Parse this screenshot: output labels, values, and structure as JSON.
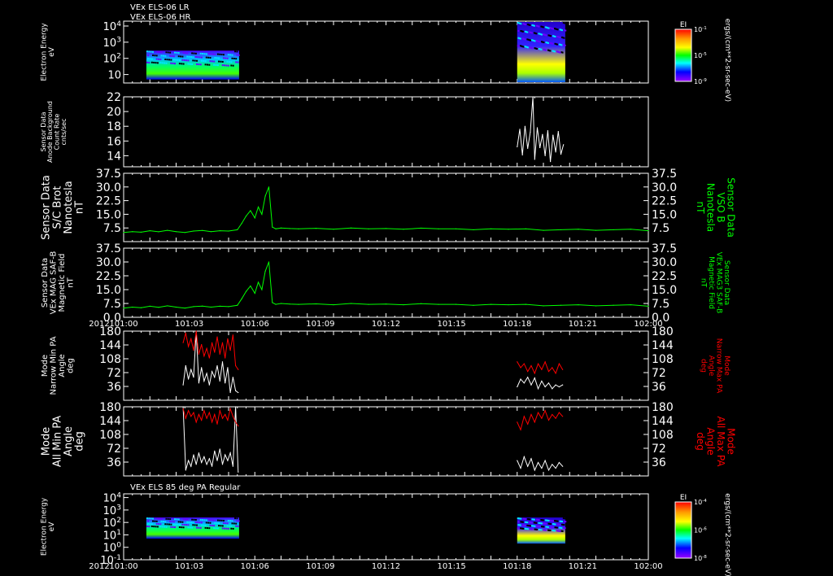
{
  "header": {
    "line1": "VEx ELS-06 LR",
    "line2": "VEx ELS-06 HR",
    "bottom_panel_title": "VEx ELS 85 deg PA Regular"
  },
  "colors": {
    "background": "#000000",
    "frame": "#ffffff",
    "text": "#ffffff",
    "green": "#00ff00",
    "red": "#ff0000"
  },
  "xaxis": {
    "year_label": "2012",
    "ticks": [
      "101:00",
      "101:03",
      "101:06",
      "101:09",
      "101:12",
      "101:15",
      "101:18",
      "101:21",
      "102:00"
    ],
    "range_minutes": [
      0,
      60
    ]
  },
  "chart_data": [
    {
      "id": "p1",
      "type": "heatmap",
      "ylabel_lines": [
        "Electron Energy",
        "eV"
      ],
      "ylog": true,
      "yticks": [
        "10",
        "10^2",
        "10^3",
        "10^4"
      ],
      "colorbar": {
        "title": "EI",
        "ticks": [
          "10^-1",
          "10^-5",
          "10^-9"
        ],
        "label": "ergs/(cm**2-sr-sec-eV)"
      },
      "blocks": [
        {
          "x0": 2.6,
          "x1": 13.2,
          "e0": 5,
          "e1": 300
        },
        {
          "x0": 45.0,
          "x1": 50.5,
          "e0": 3,
          "e1": 30000
        }
      ]
    },
    {
      "id": "p2",
      "type": "line",
      "ylabel_lines": [
        "Sensor Data",
        "Anode Background",
        "Count Rate",
        "cnts/sec"
      ],
      "ylim": [
        12.5,
        22
      ],
      "yticks": [
        "14",
        "16",
        "18",
        "20",
        "22"
      ],
      "x": [
        45.0,
        45.3,
        45.6,
        45.9,
        46.2,
        46.5,
        46.8,
        47.0,
        47.3,
        47.6,
        47.9,
        48.2,
        48.5,
        48.8,
        49.1,
        49.4,
        49.7,
        50.0,
        50.3
      ],
      "values": [
        15.2,
        17.6,
        14.1,
        18.0,
        15.0,
        17.2,
        22.0,
        13.5,
        17.8,
        15.1,
        16.9,
        14.0,
        17.4,
        13.2,
        16.8,
        14.5,
        17.3,
        14.2,
        15.5
      ]
    },
    {
      "id": "p3",
      "type": "line",
      "ylabel_lines": [
        "Sensor Data",
        "S/C Brot",
        "Nanotesla",
        "nT"
      ],
      "rlabel_lines": [
        "Sensor Data",
        "VSO B",
        "Nanotesla",
        "nT"
      ],
      "ylim": [
        0,
        37.5
      ],
      "yticks": [
        "7.5",
        "15.0",
        "22.5",
        "30.0",
        "37.5"
      ],
      "rticks": [
        "7.5",
        "15.0",
        "22.5",
        "30.0",
        "37.5"
      ],
      "x": [
        0,
        1,
        2,
        3,
        4,
        5,
        6,
        7,
        8,
        9,
        10,
        11,
        12,
        13,
        13.5,
        14,
        14.5,
        15,
        15.4,
        15.8,
        16.2,
        16.6,
        17.0,
        17.4,
        18,
        19,
        20,
        22,
        24,
        26,
        28,
        30,
        32,
        34,
        36,
        38,
        40,
        42,
        44,
        46,
        48,
        50,
        52,
        54,
        56,
        58,
        60
      ],
      "values": [
        5,
        5.5,
        5.2,
        6,
        5.4,
        6.2,
        5.5,
        5,
        5.8,
        6.1,
        5.5,
        6,
        5.8,
        6.5,
        10,
        14,
        17,
        13,
        19,
        15,
        25,
        30,
        8,
        7,
        7.5,
        7.2,
        7,
        7.3,
        6.8,
        7.5,
        7,
        7.2,
        6.8,
        7.4,
        7,
        7,
        6.5,
        7,
        6.8,
        7,
        6.2,
        6.5,
        6.8,
        6.2,
        6.5,
        6.8,
        6
      ]
    },
    {
      "id": "p4",
      "type": "line",
      "ylabel_lines": [
        "Sensor Data",
        "VEx MAG SAF-B",
        "Magnetic Field",
        "nT"
      ],
      "rlabel_lines": [
        "Sensor Data",
        "VEx MAG3 SAF-B",
        "Magnetic Field",
        "nT"
      ],
      "ylim": [
        0,
        37.5
      ],
      "yticks": [
        "0.0",
        "7.5",
        "15.0",
        "22.5",
        "30.0",
        "37.5"
      ],
      "rticks": [
        "0.0",
        "7.5",
        "15.0",
        "22.5",
        "30.0",
        "37.5"
      ],
      "x": [
        0,
        1,
        2,
        3,
        4,
        5,
        6,
        7,
        8,
        9,
        10,
        11,
        12,
        13,
        13.5,
        14,
        14.5,
        15,
        15.4,
        15.8,
        16.2,
        16.6,
        17.0,
        17.4,
        18,
        19,
        20,
        22,
        24,
        26,
        28,
        30,
        32,
        34,
        36,
        38,
        40,
        42,
        44,
        46,
        48,
        50,
        52,
        54,
        56,
        58,
        60
      ],
      "values": [
        5,
        5.5,
        5.2,
        6,
        5.4,
        6.2,
        5.5,
        5,
        5.8,
        6.1,
        5.5,
        6,
        5.8,
        6.5,
        10,
        14,
        17,
        13,
        19,
        15,
        25,
        30,
        8,
        7,
        7.5,
        7.2,
        7,
        7.3,
        6.8,
        7.5,
        7,
        7.2,
        6.8,
        7.4,
        7,
        7,
        6.5,
        7,
        6.8,
        7,
        6.2,
        6.5,
        6.8,
        6.2,
        6.5,
        6.8,
        6
      ]
    },
    {
      "id": "p5",
      "type": "line",
      "ylabel_lines": [
        "Mode",
        "Narrow Min PA",
        "Angle",
        "deg"
      ],
      "rlabel_lines": [
        "Mode",
        "Narrow Max PA",
        "Angle",
        "deg"
      ],
      "ylim": [
        0,
        180
      ],
      "yticks": [
        "36",
        "72",
        "108",
        "144",
        "180"
      ],
      "rticks": [
        "36",
        "72",
        "108",
        "144",
        "180"
      ],
      "series": [
        {
          "color": "white",
          "segments": [
            {
              "x": [
                6.8,
                7.1,
                7.4,
                7.7,
                8.0,
                8.3,
                8.6,
                8.9,
                9.2,
                9.5,
                9.8,
                10.1,
                10.4,
                10.7,
                11.0,
                11.3,
                11.6,
                11.9,
                12.2,
                12.5,
                12.8,
                13.1
              ],
              "values": [
                40,
                90,
                55,
                80,
                60,
                180,
                45,
                85,
                50,
                70,
                40,
                75,
                60,
                90,
                50,
                100,
                45,
                85,
                20,
                60,
                25,
                20
              ]
            },
            {
              "x": [
                45.0,
                45.4,
                45.8,
                46.2,
                46.6,
                47.0,
                47.4,
                47.8,
                48.2,
                48.6,
                49.0,
                49.4,
                49.8,
                50.2
              ],
              "values": [
                35,
                55,
                45,
                60,
                40,
                58,
                30,
                50,
                35,
                45,
                30,
                40,
                35,
                40
              ]
            }
          ]
        },
        {
          "color": "red",
          "segments": [
            {
              "x": [
                6.8,
                7.1,
                7.4,
                7.7,
                8.0,
                8.3,
                8.6,
                8.9,
                9.2,
                9.5,
                9.8,
                10.1,
                10.4,
                10.7,
                11.0,
                11.3,
                11.6,
                11.9,
                12.2,
                12.5,
                12.8,
                13.1
              ],
              "values": [
                150,
                175,
                140,
                160,
                130,
                180,
                120,
                145,
                115,
                135,
                110,
                150,
                125,
                165,
                120,
                150,
                110,
                160,
                130,
                170,
                90,
                80
              ]
            },
            {
              "x": [
                45.0,
                45.4,
                45.8,
                46.2,
                46.6,
                47.0,
                47.4,
                47.8,
                48.2,
                48.6,
                49.0,
                49.4,
                49.8,
                50.2
              ],
              "values": [
                100,
                85,
                95,
                75,
                90,
                70,
                95,
                80,
                100,
                75,
                85,
                70,
                95,
                80
              ]
            }
          ]
        }
      ]
    },
    {
      "id": "p6",
      "type": "line",
      "ylabel_lines": [
        "Mode",
        "All Min PA",
        "Angle",
        "deg"
      ],
      "rlabel_lines": [
        "Mode",
        "All Max PA",
        "Angle",
        "deg"
      ],
      "ylim": [
        0,
        180
      ],
      "yticks": [
        "36",
        "72",
        "108",
        "144",
        "180"
      ],
      "rticks": [
        "36",
        "72",
        "108",
        "144",
        "180"
      ],
      "series": [
        {
          "color": "white",
          "segments": [
            {
              "x": [
                6.8,
                7.1,
                7.4,
                7.7,
                8.0,
                8.3,
                8.6,
                8.9,
                9.2,
                9.5,
                9.8,
                10.1,
                10.4,
                10.7,
                11.0,
                11.3,
                11.6,
                11.9,
                12.2,
                12.5,
                12.8,
                13.1
              ],
              "values": [
                180,
                15,
                40,
                25,
                55,
                30,
                60,
                35,
                50,
                30,
                45,
                25,
                65,
                40,
                70,
                30,
                55,
                40,
                60,
                25,
                180,
                10
              ]
            },
            {
              "x": [
                45.0,
                45.4,
                45.8,
                46.2,
                46.6,
                47.0,
                47.4,
                47.8,
                48.2,
                48.6,
                49.0,
                49.4,
                49.8,
                50.2
              ],
              "values": [
                40,
                20,
                50,
                25,
                45,
                15,
                35,
                20,
                40,
                15,
                30,
                20,
                35,
                25
              ]
            }
          ]
        },
        {
          "color": "red",
          "segments": [
            {
              "x": [
                6.8,
                7.1,
                7.4,
                7.7,
                8.0,
                8.3,
                8.6,
                8.9,
                9.2,
                9.5,
                9.8,
                10.1,
                10.4,
                10.7,
                11.0,
                11.3,
                11.6,
                11.9,
                12.2,
                12.5,
                12.8,
                13.1
              ],
              "values": [
                175,
                150,
                170,
                155,
                165,
                140,
                160,
                145,
                170,
                150,
                165,
                140,
                160,
                135,
                170,
                150,
                160,
                145,
                175,
                155,
                140,
                130
              ]
            },
            {
              "x": [
                45.0,
                45.4,
                45.8,
                46.2,
                46.6,
                47.0,
                47.4,
                47.8,
                48.2,
                48.6,
                49.0,
                49.4,
                49.8,
                50.2
              ],
              "values": [
                140,
                120,
                155,
                135,
                160,
                140,
                165,
                150,
                170,
                145,
                160,
                150,
                165,
                155
              ]
            }
          ]
        }
      ]
    },
    {
      "id": "p7",
      "type": "heatmap",
      "ylabel_lines": [
        "Electron Energy",
        "eV"
      ],
      "ylog": true,
      "yticks": [
        "10^-1",
        "10^0",
        "10^1",
        "10^2",
        "10^3",
        "10^4"
      ],
      "colorbar": {
        "title": "EI",
        "ticks": [
          "10^-4",
          "10^-6",
          "10^-8"
        ],
        "label": "ergs/(cm**2-sr-sec-eV)"
      },
      "blocks": [
        {
          "x0": 2.6,
          "x1": 13.2,
          "e0": 5,
          "e1": 250
        },
        {
          "x0": 45.0,
          "x1": 50.5,
          "e0": 2,
          "e1": 250
        }
      ]
    }
  ]
}
